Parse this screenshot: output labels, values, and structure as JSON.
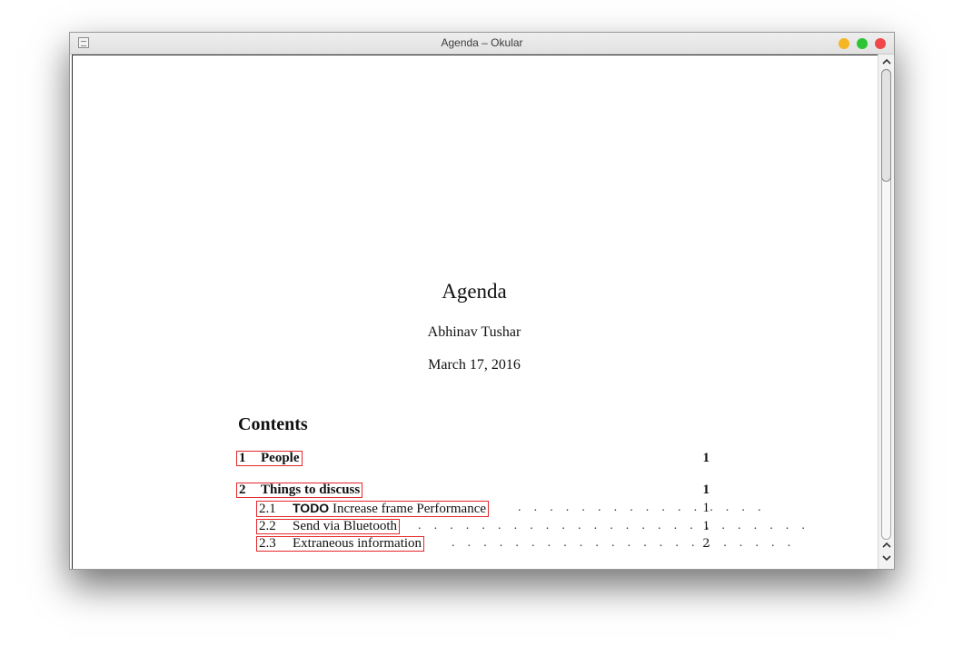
{
  "window": {
    "title": "Agenda – Okular"
  },
  "document": {
    "title": "Agenda",
    "author": "Abhinav Tushar",
    "date": "March 17, 2016",
    "contents_heading": "Contents",
    "toc": [
      {
        "number": "1",
        "label": "People",
        "page": "1",
        "level": 1
      },
      {
        "number": "2",
        "label": "Things to discuss",
        "page": "1",
        "level": 1
      },
      {
        "number": "2.1",
        "keyword": "TODO",
        "label": "Increase frame Performance",
        "page": "1",
        "level": 2
      },
      {
        "number": "2.2",
        "label": "Send via Bluetooth",
        "page": "1",
        "level": 2
      },
      {
        "number": "2.3",
        "label": "Extraneous information",
        "page": "2",
        "level": 2
      }
    ]
  },
  "scrollbar": {
    "up_icon": "chevron-up-icon",
    "down_icon": "chevron-down-icon"
  },
  "colors": {
    "link_border": "#e4282b",
    "minimize": "#f5b623",
    "maximize": "#2cc433",
    "close": "#f0454b"
  }
}
